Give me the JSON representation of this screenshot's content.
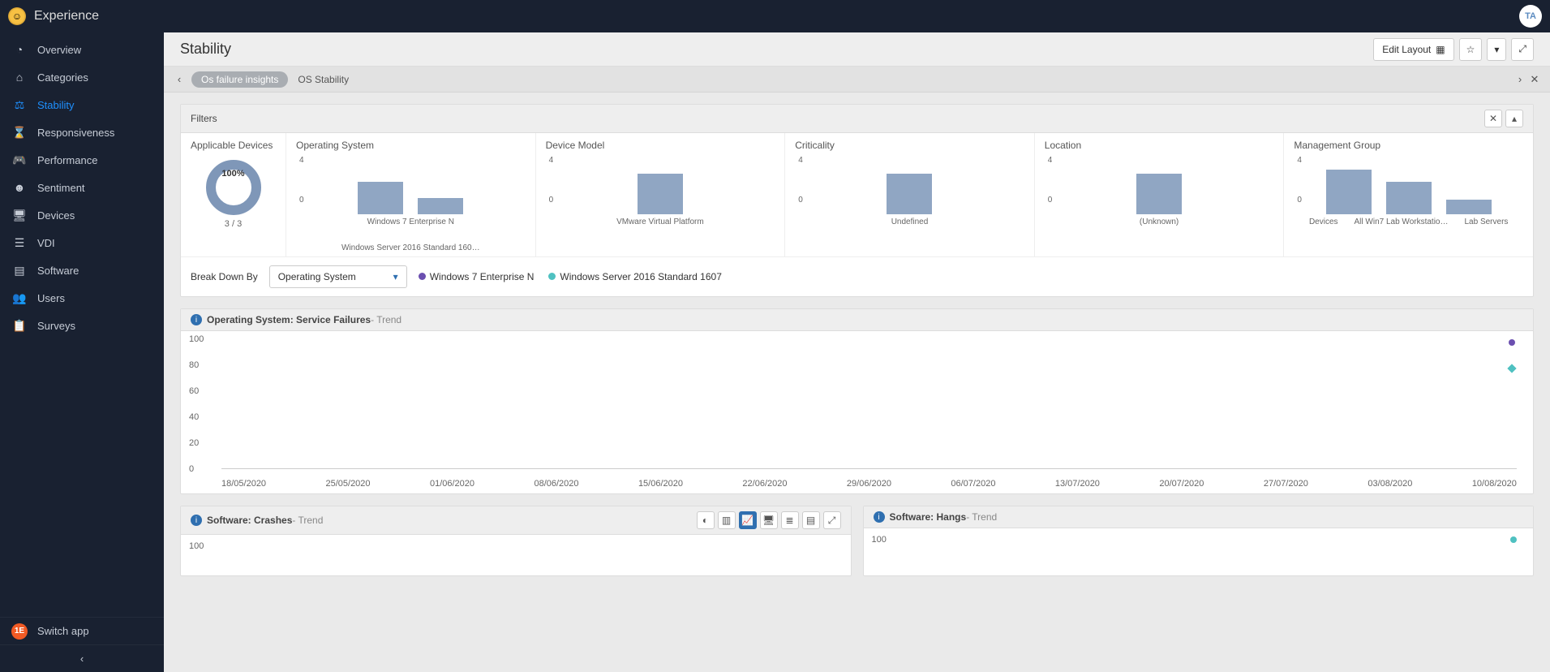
{
  "app": {
    "title": "Experience",
    "avatar": "TA"
  },
  "sidebar": {
    "items": [
      {
        "label": "Overview",
        "icon": "◔"
      },
      {
        "label": "Categories",
        "icon": "⌂"
      },
      {
        "label": "Stability",
        "icon": "⚖",
        "active": true
      },
      {
        "label": "Responsiveness",
        "icon": "⌛"
      },
      {
        "label": "Performance",
        "icon": "🎮"
      },
      {
        "label": "Sentiment",
        "icon": "☻"
      },
      {
        "label": "Devices",
        "icon": "🖥"
      },
      {
        "label": "VDI",
        "icon": "☰"
      },
      {
        "label": "Software",
        "icon": "▤"
      },
      {
        "label": "Users",
        "icon": "👥"
      },
      {
        "label": "Surveys",
        "icon": "📋"
      }
    ],
    "switch_label": "Switch app"
  },
  "page": {
    "title": "Stability",
    "edit_layout": "Edit Layout",
    "crumbs": {
      "active": "Os failure insights",
      "next": "OS Stability"
    }
  },
  "filters": {
    "title": "Filters",
    "applicable": {
      "title": "Applicable Devices",
      "percent": "100%",
      "ratio": "3 / 3"
    },
    "cols": [
      {
        "title": "Operating System",
        "ymax": "4",
        "bars": [
          40,
          20
        ],
        "labels": [
          "Windows 7 Enterprise N",
          "Windows Server 2016 Standard 160…"
        ]
      },
      {
        "title": "Device Model",
        "ymax": "4",
        "bars": [
          50
        ],
        "labels": [
          "VMware Virtual Platform"
        ]
      },
      {
        "title": "Criticality",
        "ymax": "4",
        "bars": [
          50
        ],
        "labels": [
          "Undefined"
        ]
      },
      {
        "title": "Location",
        "ymax": "4",
        "bars": [
          50
        ],
        "labels": [
          "(Unknown)"
        ]
      },
      {
        "title": "Management Group",
        "ymax": "4",
        "bars": [
          55,
          40,
          18
        ],
        "labels": [
          "Devices",
          "All Win7 Lab Workstatio…",
          "Lab Servers"
        ]
      }
    ],
    "breakdown_label": "Break Down By",
    "breakdown_value": "Operating System",
    "legend": [
      {
        "color": "#6b4fb0",
        "label": "Windows 7 Enterprise N"
      },
      {
        "color": "#4fc1c1",
        "label": "Windows Server 2016 Standard 1607"
      }
    ]
  },
  "trend": {
    "title": "Operating System: Service Failures",
    "suffix": " - Trend",
    "yticks": [
      "100",
      "80",
      "60",
      "40",
      "20",
      "0"
    ],
    "xticks": [
      "18/05/2020",
      "25/05/2020",
      "01/06/2020",
      "08/06/2020",
      "15/06/2020",
      "22/06/2020",
      "29/06/2020",
      "06/07/2020",
      "13/07/2020",
      "20/07/2020",
      "27/07/2020",
      "03/08/2020",
      "10/08/2020"
    ]
  },
  "chart_data": {
    "type": "line",
    "title": "Operating System: Service Failures - Trend",
    "xlabel": "",
    "ylabel": "",
    "ylim": [
      0,
      100
    ],
    "x": [
      "18/05/2020",
      "25/05/2020",
      "01/06/2020",
      "08/06/2020",
      "15/06/2020",
      "22/06/2020",
      "29/06/2020",
      "06/07/2020",
      "13/07/2020",
      "20/07/2020",
      "27/07/2020",
      "03/08/2020",
      "10/08/2020"
    ],
    "series": [
      {
        "name": "Windows 7 Enterprise N",
        "color": "#6b4fb0",
        "values": [
          null,
          null,
          null,
          null,
          null,
          null,
          null,
          null,
          null,
          null,
          null,
          null,
          100
        ]
      },
      {
        "name": "Windows Server 2016 Standard 1607",
        "color": "#4fc1c1",
        "values": [
          null,
          null,
          null,
          null,
          null,
          null,
          null,
          null,
          null,
          null,
          null,
          null,
          80
        ]
      }
    ]
  },
  "crashes": {
    "title": "Software: Crashes",
    "suffix": " - Trend",
    "ytick": "100"
  },
  "hangs": {
    "title": "Software: Hangs",
    "suffix": " - Trend",
    "ytick": "100"
  }
}
